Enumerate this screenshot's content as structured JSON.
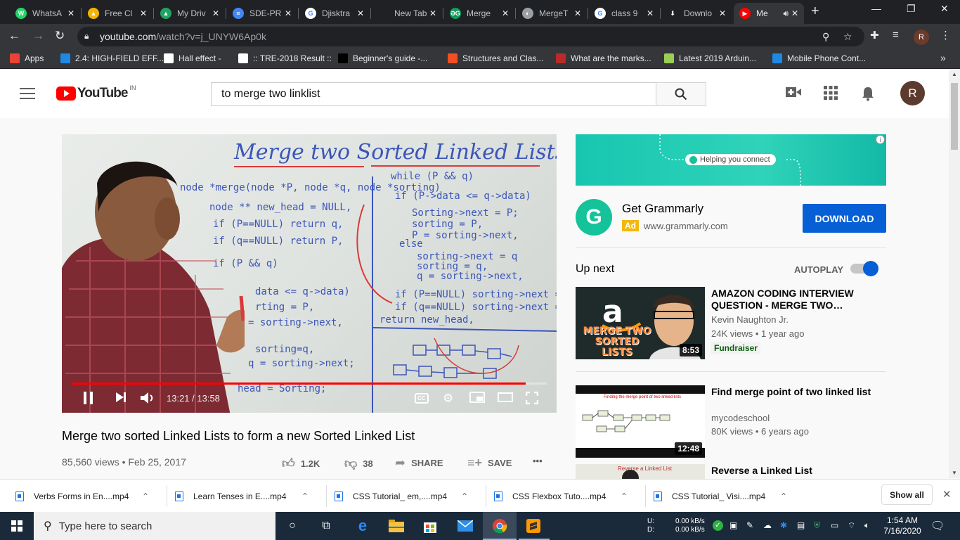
{
  "browser": {
    "tabs": [
      {
        "title": "WhatsA",
        "color": "#25d366",
        "glyph": "W"
      },
      {
        "title": "Free Cl",
        "color": "#f4b400",
        "glyph": "▲"
      },
      {
        "title": "My Driv",
        "color": "#1fa463",
        "glyph": "▲"
      },
      {
        "title": "SDE-PR",
        "color": "#4285f4",
        "glyph": "≡"
      },
      {
        "title": "Djisktra",
        "color": "#ffffff",
        "glyph": "G"
      },
      {
        "title": "New Tab",
        "color": "#202124",
        "glyph": ""
      },
      {
        "title": "Merge",
        "color": "#0f9d58",
        "glyph": "ƏG"
      },
      {
        "title": "MergeT",
        "color": "#9aa0a6",
        "glyph": "◐"
      },
      {
        "title": "class 9",
        "color": "#ffffff",
        "glyph": "G"
      },
      {
        "title": "Downlo",
        "color": "#202124",
        "glyph": "⬇"
      },
      {
        "title": "Me",
        "color": "#ff0000",
        "glyph": "▶",
        "active": true
      }
    ],
    "url_host": "youtube.com",
    "url_path": "/watch?v=j_UNYW6Ap0k",
    "profile_initial": "R",
    "bookmarks": [
      {
        "label": "Apps",
        "color": "#ea4335"
      },
      {
        "label": "2.4: HIGH-FIELD EFF...",
        "color": "#1e88e5"
      },
      {
        "label": "Hall effect -",
        "color": "#ffffff"
      },
      {
        "label": ":: TRE-2018 Result ::",
        "color": "#ffffff"
      },
      {
        "label": "Beginner's guide -...",
        "color": "#000000"
      },
      {
        "label": "Structures and Clas...",
        "color": "#f25022"
      },
      {
        "label": "What are the marks...",
        "color": "#b92b27"
      },
      {
        "label": "Latest 2019 Arduin...",
        "color": "#9bcf53"
      },
      {
        "label": "Mobile Phone Cont...",
        "color": "#1e88e5"
      }
    ],
    "bookmarks_more": "»"
  },
  "youtube": {
    "logo_text": "YouTube",
    "country": "IN",
    "search_query": "to merge two linklist",
    "avatar_initial": "R"
  },
  "video": {
    "time": "13:21 / 13:58",
    "progress_fraction": 0.956,
    "cc_label": "CC",
    "title": "Merge two sorted Linked Lists to form a new Sorted Linked List",
    "views_date": "85,560 views • Feb 25, 2017",
    "likes": "1.2K",
    "dislikes": "38",
    "share": "SHARE",
    "save": "SAVE",
    "more": "•••",
    "board_title": "Merge two Sorted Linked Lists"
  },
  "ad": {
    "banner_text": "Helping you connect",
    "name": "Get Grammarly",
    "tag": "Ad",
    "url": "www.grammarly.com",
    "cta": "DOWNLOAD",
    "logo_letter": "G"
  },
  "sidebar": {
    "up_next": "Up next",
    "autoplay": "AUTOPLAY",
    "autoplay_on": true,
    "videos": [
      {
        "title": "AMAZON CODING INTERVIEW QUESTION - MERGE TWO…",
        "channel": "Kevin Naughton Jr.",
        "meta": "24K views • 1 year ago",
        "duration": "8:53",
        "badge": "Fundraiser",
        "thumb_text": "MERGE TWO SORTED LISTS"
      },
      {
        "title": "Find merge point of two linked list",
        "channel": "mycodeschool",
        "meta": "80K views • 6 years ago",
        "duration": "12:48",
        "thumb_text": "Finding the merge point of two linked lists"
      },
      {
        "title": "Reverse a Linked List",
        "thumb_text": "Reverse a Linked List"
      }
    ]
  },
  "downloads": [
    {
      "name": "Verbs Forms in En....mp4"
    },
    {
      "name": "Learn Tenses in E....mp4"
    },
    {
      "name": "CSS Tutorial_ em,....mp4"
    },
    {
      "name": "CSS Flexbox Tuto....mp4"
    },
    {
      "name": "CSS Tutorial_ Visi....mp4"
    }
  ],
  "downloads_show_all": "Show all",
  "taskbar": {
    "search_placeholder": "Type here to search",
    "net_up": "0.00 kB/s",
    "net_down": "0.00 kB/s",
    "net_up_label": "U:",
    "net_down_label": "D:",
    "time": "1:54 AM",
    "date": "7/16/2020"
  }
}
